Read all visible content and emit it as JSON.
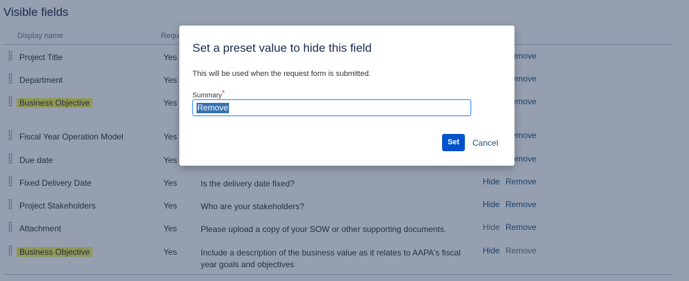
{
  "section_title": "Visible fields",
  "columns": {
    "display_name": "Display name",
    "required": "Requi"
  },
  "rows": [
    {
      "name": "Project Title",
      "required": "Yes",
      "question": "",
      "hide": "",
      "remove": "Remove"
    },
    {
      "name": "Department",
      "required": "Yes",
      "question": "",
      "hide": "",
      "remove": "Remove"
    },
    {
      "name": "Business Objective",
      "required": "Yes",
      "question": "",
      "hide": "",
      "remove": "Remove"
    },
    {
      "name": "Fiscal Year Operation Model",
      "required": "Yes",
      "question": "",
      "hide": "",
      "remove": "Remove"
    },
    {
      "name": "Due date",
      "required": "Yes",
      "question": "",
      "hide": "",
      "remove": "Remove"
    },
    {
      "name": "Fixed Delivery Date",
      "required": "Yes",
      "question": "Is the delivery date fixed?",
      "hide": "Hide",
      "remove": "Remove"
    },
    {
      "name": "Project Stakeholders",
      "required": "Yes",
      "question": "Who are your stakeholders?",
      "hide": "Hide",
      "remove": "Remove"
    },
    {
      "name": "Attachment",
      "required": "Yes",
      "question": "Please upload a copy of your SOW or other supporting documents.",
      "hide": "Hide",
      "remove": "Remove"
    },
    {
      "name": "Business Objective",
      "required": "Yes",
      "question": "Include a description of the business value as it relates to AAPA's fiscal year goals and objectives",
      "hide": "Hide",
      "remove": "Remove"
    }
  ],
  "dialog": {
    "title": "Set a preset value to hide this field",
    "description": "This will be used when the request form is submitted.",
    "field_label": "Summary",
    "required_marker": "*",
    "field_value": "Remove",
    "set_label": "Set",
    "cancel_label": "Cancel"
  },
  "colors": {
    "highlight": "#f5f35c",
    "primary_button": "#0052cc",
    "link": "#205081",
    "overlay": "rgba(23,43,77,0.45)"
  }
}
